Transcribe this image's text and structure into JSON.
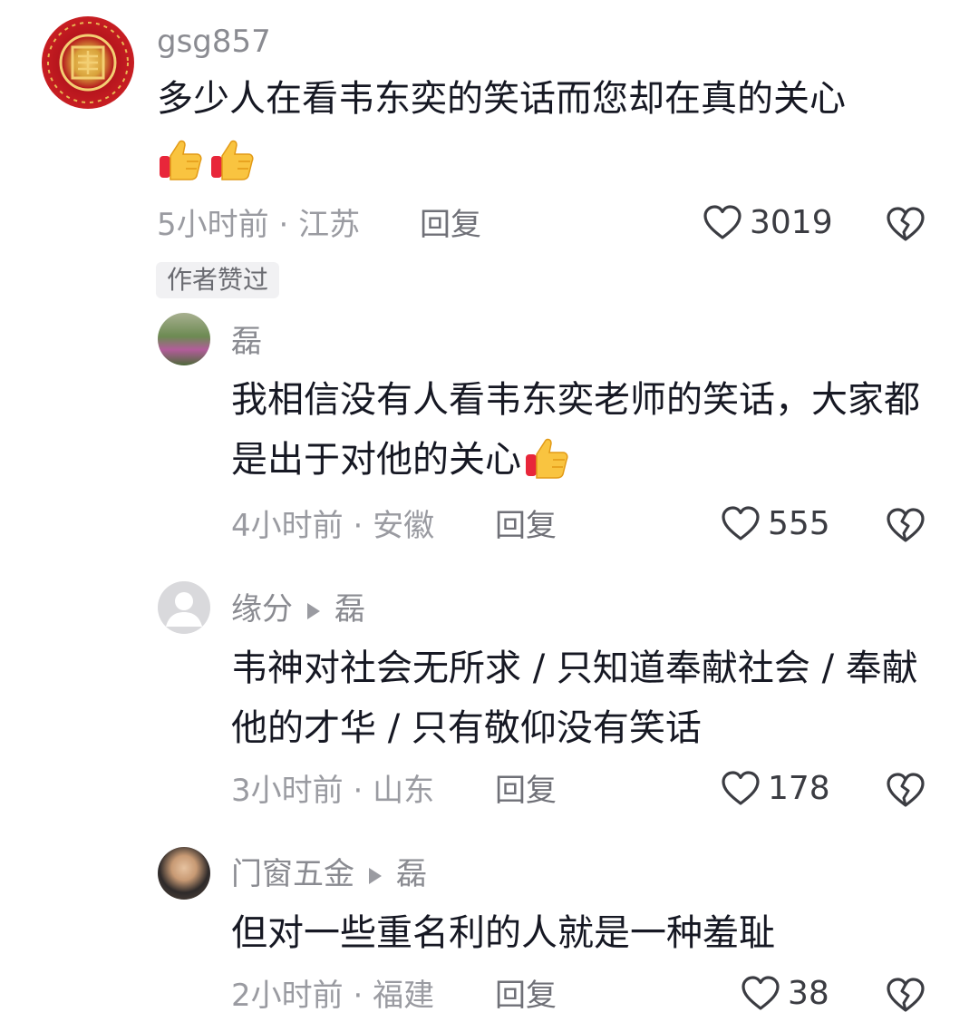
{
  "colors": {
    "text": "#161823",
    "meta": "#9a9ba1",
    "username": "#8a8b91",
    "badge_bg": "#f1f1f3"
  },
  "comments": [
    {
      "username": "gsg857",
      "text": "多少人在看韦东奕的笑话而您却在真的关心",
      "emoji": [
        "thumbs-up",
        "thumbs-up"
      ],
      "time": "5小时前",
      "location": "江苏",
      "reply_label": "回复",
      "likes": "3019",
      "badge": "作者赞过"
    },
    {
      "username": "磊",
      "text": "我相信没有人看韦东奕老师的笑话，大家都是出于对他的关心",
      "emoji": [
        "thumbs-up"
      ],
      "time": "4小时前",
      "location": "安徽",
      "reply_label": "回复",
      "likes": "555"
    },
    {
      "username": "缘分",
      "reply_to": "磊",
      "text": "韦神对社会无所求 / 只知道奉献社会 / 奉献他的才华 / 只有敬仰没有笑话",
      "time": "3小时前",
      "location": "山东",
      "reply_label": "回复",
      "likes": "178"
    },
    {
      "username": "门窗五金",
      "reply_to": "磊",
      "text": "但对一些重名利的人就是一种羞耻",
      "time": "2小时前",
      "location": "福建",
      "reply_label": "回复",
      "likes": "38"
    }
  ]
}
